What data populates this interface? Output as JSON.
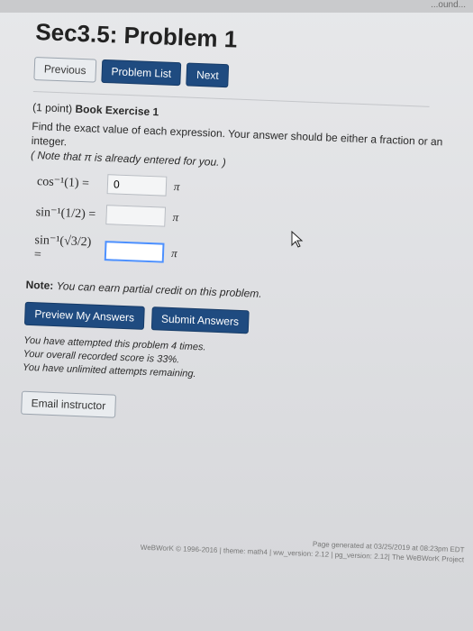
{
  "top_right_text": "...ound...",
  "page_title": "Sec3.5: Problem 1",
  "nav": {
    "previous": "Previous",
    "problem_list": "Problem List",
    "next": "Next"
  },
  "problem": {
    "points": "(1 point)",
    "book_label": "Book Exercise 1",
    "instruction": "Find the exact value of each expression. Your answer should be either a fraction or an integer.",
    "note_pi": "( Note that π is already entered for you. )"
  },
  "rows": [
    {
      "expr": "cos⁻¹(1) =",
      "value": "0",
      "suffix": "π"
    },
    {
      "expr": "sin⁻¹(1/2) =",
      "value": "",
      "suffix": "π"
    },
    {
      "expr": "sin⁻¹(√3/2) =",
      "value": "",
      "suffix": "π"
    }
  ],
  "note": {
    "label": "Note:",
    "text": "You can earn partial credit on this problem."
  },
  "actions": {
    "preview": "Preview My Answers",
    "submit": "Submit Answers"
  },
  "status": {
    "line1": "You have attempted this problem 4 times.",
    "line2": "Your overall recorded score is 33%.",
    "line3": "You have unlimited attempts remaining."
  },
  "email": "Email instructor",
  "footer": {
    "line1": "Page generated at 03/25/2019 at 08:23pm EDT",
    "line2": "WeBWorK © 1996-2016 | theme: math4 | ww_version: 2.12 | pg_version: 2.12| The WeBWorK Project"
  },
  "colors": {
    "primary_button": "#1f4b80",
    "focus_border": "#4d90fe",
    "background": "#e2e3e5"
  },
  "icons": [
    "mouse-pointer-icon"
  ]
}
